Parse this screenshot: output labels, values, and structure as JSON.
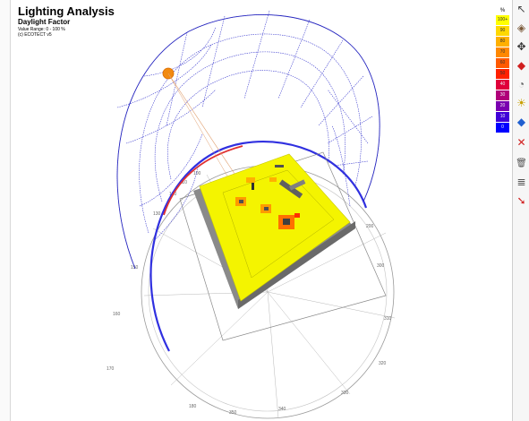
{
  "header": {
    "title": "Lighting Analysis",
    "subtitle": "Daylight Factor",
    "value_range": "Value Range: 0 - 100 %",
    "credit": "(c) ECOTECT v5"
  },
  "legend": {
    "unit": "%",
    "steps": [
      {
        "label": "100+",
        "color": "#ffff00"
      },
      {
        "label": "90",
        "color": "#ffd800"
      },
      {
        "label": "80",
        "color": "#ffb000"
      },
      {
        "label": "70",
        "color": "#ff8800"
      },
      {
        "label": "60",
        "color": "#ff5a00"
      },
      {
        "label": "50",
        "color": "#ff2000"
      },
      {
        "label": "40",
        "color": "#e0003a"
      },
      {
        "label": "30",
        "color": "#b0007a"
      },
      {
        "label": "20",
        "color": "#7a00b0"
      },
      {
        "label": "10",
        "color": "#4000d8"
      },
      {
        "label": "0",
        "color": "#0000ff"
      }
    ]
  },
  "compass": {
    "labels": [
      "100",
      "110",
      "120",
      "130",
      "150",
      "160",
      "170",
      "180",
      "200",
      "300",
      "310",
      "320",
      "330",
      "340",
      "350"
    ]
  },
  "toolbar": {
    "tools": [
      {
        "icon": "cursor-arrow-icon",
        "glyph": "↖"
      },
      {
        "icon": "paint-bucket-icon",
        "glyph": "◈"
      },
      {
        "icon": "node-edit-icon",
        "glyph": "✥"
      },
      {
        "icon": "fill-tool-icon",
        "glyph": "◆"
      },
      {
        "icon": "zoom-icon",
        "glyph": "◔"
      },
      {
        "icon": "sun-icon",
        "glyph": "☀"
      },
      {
        "icon": "gem-icon",
        "glyph": "◆"
      },
      {
        "icon": "cross-marker-icon",
        "glyph": "✕"
      },
      {
        "icon": "trash-icon",
        "glyph": "🗑"
      },
      {
        "icon": "stack-icon",
        "glyph": "≣"
      },
      {
        "icon": "export-icon",
        "glyph": "➘"
      }
    ]
  }
}
